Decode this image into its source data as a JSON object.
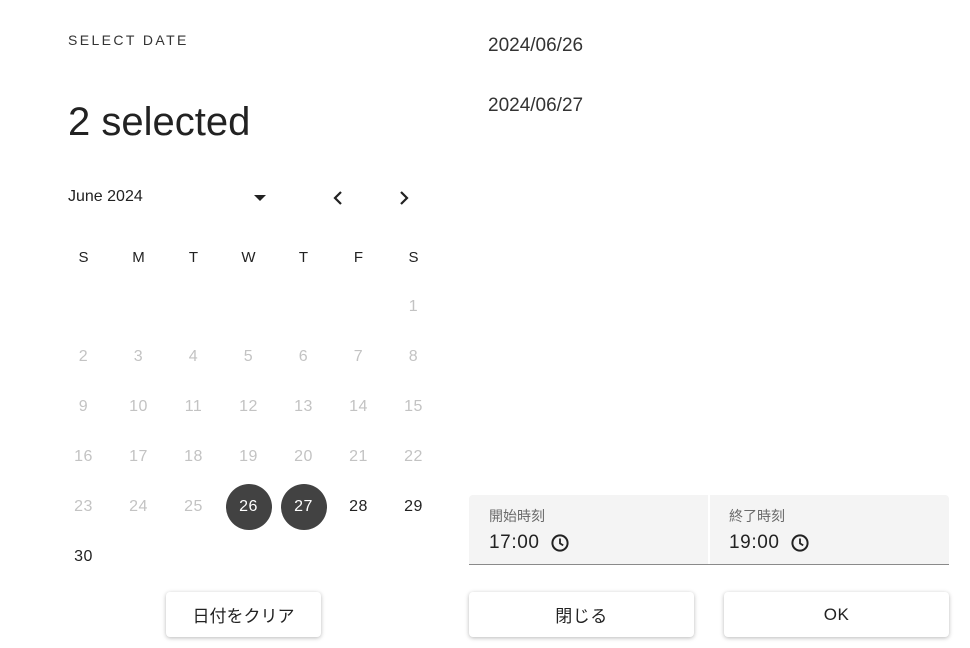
{
  "header": {
    "overline": "SELECT DATE",
    "headline": "2 selected"
  },
  "calendar": {
    "month_label": "June 2024",
    "weekdays": [
      "S",
      "M",
      "T",
      "W",
      "T",
      "F",
      "S"
    ],
    "weeks": [
      [
        "",
        "",
        "",
        "",
        "",
        "",
        "1"
      ],
      [
        "2",
        "3",
        "4",
        "5",
        "6",
        "7",
        "8"
      ],
      [
        "9",
        "10",
        "11",
        "12",
        "13",
        "14",
        "15"
      ],
      [
        "16",
        "17",
        "18",
        "19",
        "20",
        "21",
        "22"
      ],
      [
        "23",
        "24",
        "25",
        "26",
        "27",
        "28",
        "29"
      ],
      [
        "30",
        "",
        "",
        "",
        "",
        "",
        ""
      ]
    ],
    "selected_days": [
      "26",
      "27"
    ],
    "min_enabled_day": 26,
    "clear_label": "日付をクリア"
  },
  "selected_dates": [
    "2024/06/26",
    "2024/06/27"
  ],
  "time": {
    "start": {
      "label": "開始時刻",
      "value": "17:00"
    },
    "end": {
      "label": "終了時刻",
      "value": "19:00"
    }
  },
  "actions": {
    "close_label": "閉じる",
    "ok_label": "OK"
  },
  "colors": {
    "selected_bg": "#424242",
    "disabled_text": "#c3c3c3",
    "field_bg": "#f4f4f4"
  },
  "icons": {
    "month_dropdown": "caret-down-icon",
    "prev": "chevron-left-icon",
    "next": "chevron-right-icon",
    "time": "clock-icon"
  }
}
